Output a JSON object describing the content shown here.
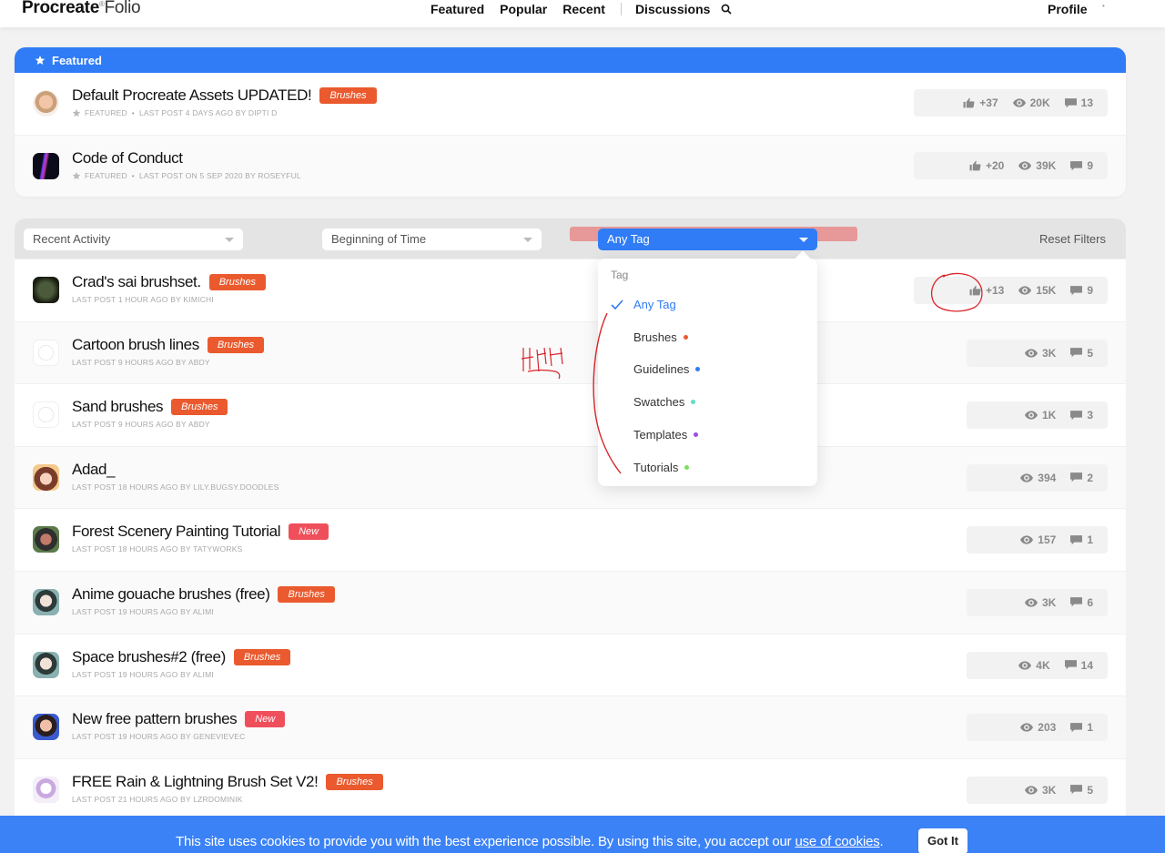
{
  "brand": {
    "name_bold": "Pro",
    "name_regular": "create",
    "registered": "®",
    "product": "Folio"
  },
  "nav": {
    "items": [
      "Featured",
      "Popular",
      "Recent",
      "Discussions"
    ],
    "profile": "Profile"
  },
  "featured": {
    "header": "Featured",
    "rows": [
      {
        "title": "Default Procreate Assets UPDATED!",
        "tag": "Brushes",
        "meta_label": "FEATURED",
        "meta": "LAST POST 4 DAYS AGO BY DIPTI D",
        "likes": "+37",
        "views": "20K",
        "comments": "13"
      },
      {
        "title": "Code of Conduct",
        "tag": "",
        "meta_label": "FEATURED",
        "meta": "LAST POST ON 5 SEP 2020 BY ROSEYFUL",
        "likes": "+20",
        "views": "39K",
        "comments": "9"
      }
    ]
  },
  "filters": {
    "sort": "Recent Activity",
    "time": "Beginning of Time",
    "tag": "Any Tag",
    "reset": "Reset Filters"
  },
  "tag_dropdown": {
    "heading": "Tag",
    "options": [
      {
        "label": "Any Tag",
        "selected": true,
        "color": ""
      },
      {
        "label": "Brushes",
        "selected": false,
        "color": "#ea5a2e"
      },
      {
        "label": "Guidelines",
        "selected": false,
        "color": "#2f7cf6"
      },
      {
        "label": "Swatches",
        "selected": false,
        "color": "#5ee0c4"
      },
      {
        "label": "Templates",
        "selected": false,
        "color": "#9b4de0"
      },
      {
        "label": "Tutorials",
        "selected": false,
        "color": "#7ae05a"
      }
    ]
  },
  "threads": [
    {
      "title": "Crad's sai brushset.",
      "tag": "Brushes",
      "tag_type": "brushes",
      "meta": "LAST POST 1 HOUR AGO BY KIMICHI",
      "likes": "+13",
      "views": "15K",
      "comments": "9"
    },
    {
      "title": "Cartoon brush lines",
      "tag": "Brushes",
      "tag_type": "brushes",
      "meta": "LAST POST 9 HOURS AGO BY ABDY",
      "likes": "",
      "views": "3K",
      "comments": "5"
    },
    {
      "title": "Sand brushes",
      "tag": "Brushes",
      "tag_type": "brushes",
      "meta": "LAST POST 9 HOURS AGO BY ABDY",
      "likes": "",
      "views": "1K",
      "comments": "3"
    },
    {
      "title": "Adad_",
      "tag": "",
      "tag_type": "",
      "meta": "LAST POST 18 HOURS AGO BY LILY.BUGSY.DOODLES",
      "likes": "",
      "views": "394",
      "comments": "2"
    },
    {
      "title": "Forest Scenery Painting Tutorial",
      "tag": "New",
      "tag_type": "new",
      "meta": "LAST POST 18 HOURS AGO BY TATYWORKS",
      "likes": "",
      "views": "157",
      "comments": "1"
    },
    {
      "title": "Anime gouache brushes (free)",
      "tag": "Brushes",
      "tag_type": "brushes",
      "meta": "LAST POST 19 HOURS AGO BY ALIMI",
      "likes": "",
      "views": "3K",
      "comments": "6"
    },
    {
      "title": "Space brushes#2 (free)",
      "tag": "Brushes",
      "tag_type": "brushes",
      "meta": "LAST POST 19 HOURS AGO BY ALIMI",
      "likes": "",
      "views": "4K",
      "comments": "14"
    },
    {
      "title": "New free pattern brushes",
      "tag": "New",
      "tag_type": "new",
      "meta": "LAST POST 19 HOURS AGO BY GENEVIEVEC",
      "likes": "",
      "views": "203",
      "comments": "1"
    },
    {
      "title": "FREE Rain & Lightning Brush Set V2!",
      "tag": "Brushes",
      "tag_type": "brushes",
      "meta": "LAST POST 21 HOURS AGO BY LZRDOMINIK",
      "likes": "",
      "views": "3K",
      "comments": "5"
    }
  ],
  "cookie": {
    "text_before": "This site uses cookies to provide you with the best experience possible. By using this site, you accept our ",
    "link": "use of cookies",
    "text_after": ".",
    "button": "Got It"
  }
}
